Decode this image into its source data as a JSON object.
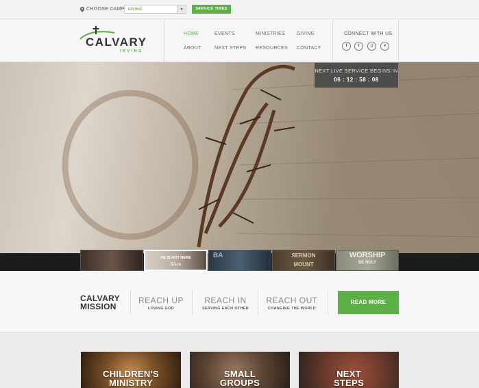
{
  "topbar": {
    "choose_campus": "CHOOSE CAMPUS",
    "campus_value": "IRVING",
    "service_times": "SERVICE TIMES"
  },
  "logo": {
    "name": "CALVARY",
    "sub": "IRVING"
  },
  "nav": {
    "home": "HOME",
    "events": "EVENTS",
    "ministries": "MINISTRIES",
    "giving": "GIVING",
    "about": "ABOUT",
    "next_steps": "NEXT STEPS",
    "resources": "RESOURCES",
    "contact": "CONTACT"
  },
  "connect": {
    "label": "CONNECT WITH US",
    "icons": [
      "facebook-icon",
      "twitter-icon",
      "instagram-icon",
      "vimeo-icon"
    ]
  },
  "hero": {
    "countdown_label": "NEXT LIVE SERVICE BEGINS IN",
    "countdown_time": "06 : 12 : 58 : 08"
  },
  "thumbs": {
    "t2_line1": "HE IS NOT HERE",
    "t2_line2": "Risen",
    "t3": "BA",
    "t4_line1": "SERMON",
    "t4_line2": "MOUNT",
    "t5_line1": "WORSHIP",
    "t5_line2": "BE HOLY"
  },
  "mission": {
    "title_line1": "CALVARY",
    "title_line2": "MISSION",
    "items": [
      {
        "heading": "REACH UP",
        "sub": "LOVING GOD"
      },
      {
        "heading": "REACH IN",
        "sub": "SERVING EACH OTHER"
      },
      {
        "heading": "REACH OUT",
        "sub": "CHANGING THE WORLD"
      }
    ],
    "read_more": "READ MORE"
  },
  "cards": [
    {
      "line1": "CHILDREN'S",
      "line2": "MINISTRY"
    },
    {
      "line1": "SMALL",
      "line2": "GROUPS"
    },
    {
      "line1": "NEXT",
      "line2": "STEPS"
    }
  ],
  "colors": {
    "accent": "#5cb045",
    "dark": "#333333"
  }
}
